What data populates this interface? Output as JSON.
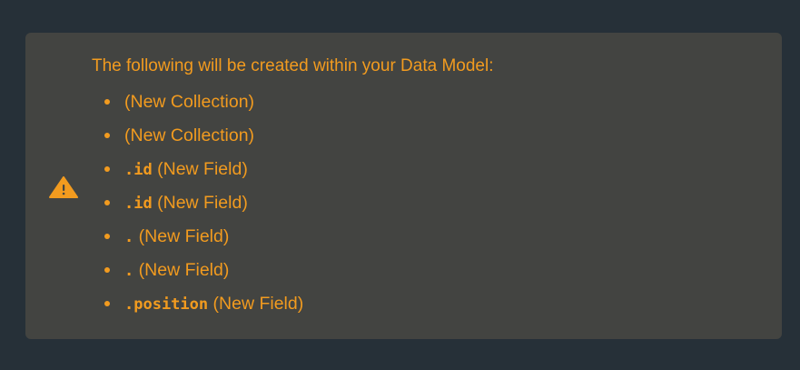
{
  "notice": {
    "title": "The following will be created within your Data Model:",
    "icon": "warning-icon",
    "accent_color": "#f29b1f",
    "background_color": "#434441",
    "items": [
      {
        "code": "",
        "text": "(New Collection)"
      },
      {
        "code": "",
        "text": "(New Collection)"
      },
      {
        "code": ".id",
        "text": " (New Field)"
      },
      {
        "code": ".id",
        "text": " (New Field)"
      },
      {
        "code": ".",
        "text": " (New Field)"
      },
      {
        "code": ".",
        "text": " (New Field)"
      },
      {
        "code": ".position",
        "text": " (New Field)"
      }
    ]
  }
}
